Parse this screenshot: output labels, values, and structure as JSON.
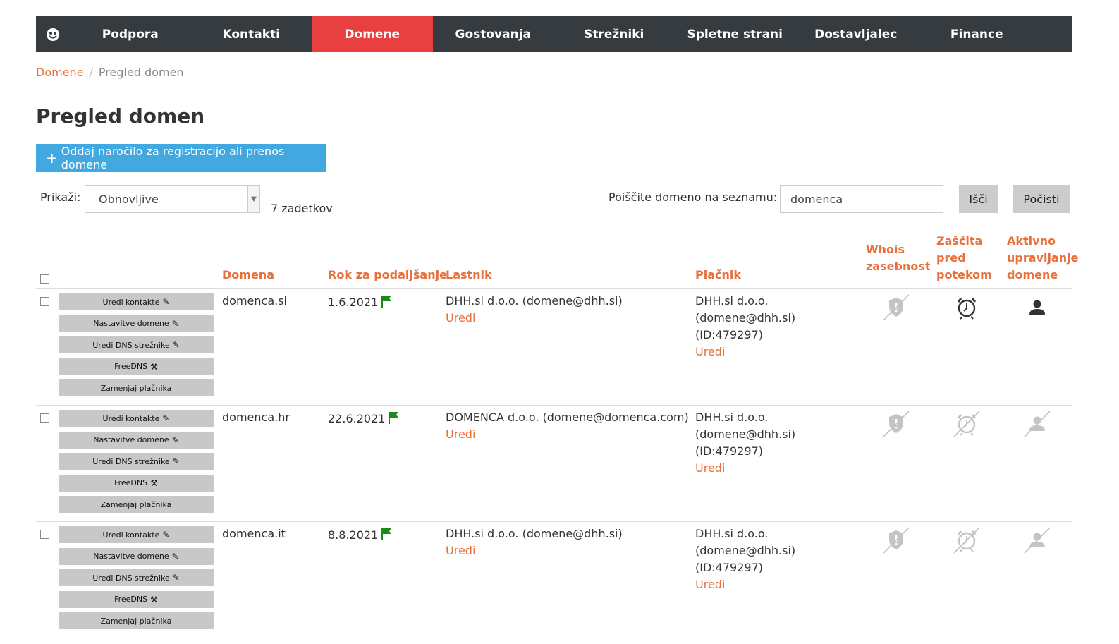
{
  "nav": {
    "logo_icon": "logo-icon",
    "items": [
      {
        "label": "Podpora"
      },
      {
        "label": "Kontakti"
      },
      {
        "label": "Domene",
        "active": true
      },
      {
        "label": "Gostovanja"
      },
      {
        "label": "Strežniki"
      },
      {
        "label": "Spletne strani"
      },
      {
        "label": "Dostavljalec"
      },
      {
        "label": "Finance"
      }
    ]
  },
  "breadcrumb": {
    "root": "Domene",
    "separator": "/",
    "current": "Pregled domen"
  },
  "page_title": "Pregled domen",
  "add_button": {
    "icon": "plus-icon",
    "label": "Oddaj naročilo za registracijo ali prenos domene"
  },
  "filter": {
    "label": "Prikaži:",
    "selected": "Obnovljive",
    "count": "7 zadetkov"
  },
  "search": {
    "label": "Poiščite domeno na seznamu:",
    "value": "domenca",
    "search_button": "Išči",
    "clear_button": "Počisti"
  },
  "table": {
    "headers": {
      "domain": "Domena",
      "renewal": "Rok za podaljšanje",
      "owner": "Lastnik",
      "payer": "Plačnik",
      "whois_line1": "Whois",
      "whois_line2": "zasebnost",
      "expiry_line1": "Zaščita",
      "expiry_line2": "pred",
      "expiry_line3": "potekom",
      "active_line1": "Aktivno",
      "active_line2": "upravljanje",
      "active_line3": "domene"
    },
    "actions": [
      {
        "label": "Uredi kontakte",
        "icon": "pencil-icon"
      },
      {
        "label": "Nastavitve domene",
        "icon": "pencil-icon"
      },
      {
        "label": "Uredi DNS strežnike",
        "icon": "pencil-icon"
      },
      {
        "label": "FreeDNS",
        "icon": "wrench-icon"
      },
      {
        "label": "Zamenjaj plačnika",
        "icon": ""
      }
    ],
    "rows": [
      {
        "domain": "domenca.si",
        "renewal": "1.6.2021",
        "owner": "DHH.si d.o.o. (domene@dhh.si)",
        "owner_edit": "Uredi",
        "payer_line1": "DHH.si d.o.o.",
        "payer_line2": "(domene@dhh.si)",
        "payer_line3": "(ID:479297)",
        "payer_edit": "Uredi",
        "whois_privacy": false,
        "expiry_protection": true,
        "active_management": true
      },
      {
        "domain": "domenca.hr",
        "renewal": "22.6.2021",
        "owner": "DOMENCA d.o.o. (domene@domenca.com)",
        "owner_edit": "Uredi",
        "payer_line1": "DHH.si d.o.o.",
        "payer_line2": "(domene@dhh.si)",
        "payer_line3": "(ID:479297)",
        "payer_edit": "Uredi",
        "whois_privacy": false,
        "expiry_protection": false,
        "active_management": false
      },
      {
        "domain": "domenca.it",
        "renewal": "8.8.2021",
        "owner": "DHH.si d.o.o. (domene@dhh.si)",
        "owner_edit": "Uredi",
        "payer_line1": "DHH.si d.o.o.",
        "payer_line2": "(domene@dhh.si)",
        "payer_line3": "(ID:479297)",
        "payer_edit": "Uredi",
        "whois_privacy": false,
        "expiry_protection": false,
        "active_management": false
      }
    ]
  },
  "colors": {
    "nav_bg": "#353b3e",
    "nav_active": "#e84040",
    "accent": "#e8703a",
    "primary_button": "#41a9e0",
    "flag": "#1a8a1a",
    "icon_active": "#333333",
    "icon_disabled": "#c4c4c4"
  }
}
